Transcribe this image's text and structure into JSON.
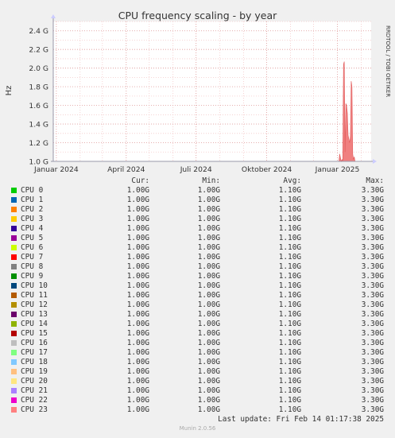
{
  "chart_data": {
    "type": "area",
    "title": "CPU frequency scaling - by year",
    "ylabel": "Hz",
    "watermark": "RRDTOOL / TOBI OETIKER",
    "ylim": [
      1.0,
      2.5
    ],
    "yticks": [
      1.0,
      1.2,
      1.4,
      1.6,
      1.8,
      2.0,
      2.2,
      2.4
    ],
    "ytick_labels": [
      "1.0 G",
      "1.2 G",
      "1.4 G",
      "1.6 G",
      "1.8 G",
      "2.0 G",
      "2.2 G",
      "2.4 G"
    ],
    "xlim": [
      "2023-12-28",
      "2025-02-14"
    ],
    "xticks": [
      "2024-01-01",
      "2024-04-01",
      "2024-07-01",
      "2024-10-01",
      "2025-01-01"
    ],
    "xtick_labels": [
      "Januar 2024",
      "April 2024",
      "Juli 2024",
      "Oktober 2024",
      "Januar 2025"
    ],
    "grid": true,
    "series": [
      {
        "name": "CPU 0",
        "color": "#f08080",
        "x": [
          "2025-01-03",
          "2025-01-04",
          "2025-01-06",
          "2025-01-07",
          "2025-01-08",
          "2025-01-09",
          "2025-01-10",
          "2025-01-11",
          "2025-01-12",
          "2025-01-13",
          "2025-01-14",
          "2025-01-15",
          "2025-01-17",
          "2025-01-18",
          "2025-01-19",
          "2025-01-20",
          "2025-01-21",
          "2025-01-22",
          "2025-01-23",
          "2025-01-24"
        ],
        "values": [
          1.0,
          1.08,
          1.0,
          1.02,
          1.0,
          2.04,
          2.07,
          1.1,
          1.62,
          1.6,
          1.52,
          1.28,
          1.2,
          1.27,
          1.86,
          1.8,
          1.08,
          1.02,
          1.05,
          1.0
        ]
      }
    ]
  },
  "legend": {
    "headers": {
      "cur": "Cur:",
      "min": "Min:",
      "avg": "Avg:",
      "max": "Max:"
    },
    "rows": [
      {
        "name": "CPU 0",
        "color": "#00cc00",
        "cur": "1.00G",
        "min": "1.00G",
        "avg": "1.10G",
        "max": "3.30G"
      },
      {
        "name": "CPU 1",
        "color": "#0066b3",
        "cur": "1.00G",
        "min": "1.00G",
        "avg": "1.10G",
        "max": "3.30G"
      },
      {
        "name": "CPU 2",
        "color": "#ff8000",
        "cur": "1.00G",
        "min": "1.00G",
        "avg": "1.10G",
        "max": "3.30G"
      },
      {
        "name": "CPU 3",
        "color": "#ffcc00",
        "cur": "1.00G",
        "min": "1.00G",
        "avg": "1.10G",
        "max": "3.30G"
      },
      {
        "name": "CPU 4",
        "color": "#330099",
        "cur": "1.00G",
        "min": "1.00G",
        "avg": "1.10G",
        "max": "3.30G"
      },
      {
        "name": "CPU 5",
        "color": "#990099",
        "cur": "1.00G",
        "min": "1.00G",
        "avg": "1.10G",
        "max": "3.30G"
      },
      {
        "name": "CPU 6",
        "color": "#ccff00",
        "cur": "1.00G",
        "min": "1.00G",
        "avg": "1.10G",
        "max": "3.30G"
      },
      {
        "name": "CPU 7",
        "color": "#ff0000",
        "cur": "1.00G",
        "min": "1.00G",
        "avg": "1.10G",
        "max": "3.30G"
      },
      {
        "name": "CPU 8",
        "color": "#808080",
        "cur": "1.00G",
        "min": "1.00G",
        "avg": "1.10G",
        "max": "3.30G"
      },
      {
        "name": "CPU 9",
        "color": "#008f00",
        "cur": "1.00G",
        "min": "1.00G",
        "avg": "1.10G",
        "max": "3.30G"
      },
      {
        "name": "CPU 10",
        "color": "#00487d",
        "cur": "1.00G",
        "min": "1.00G",
        "avg": "1.10G",
        "max": "3.30G"
      },
      {
        "name": "CPU 11",
        "color": "#b35a00",
        "cur": "1.00G",
        "min": "1.00G",
        "avg": "1.10G",
        "max": "3.30G"
      },
      {
        "name": "CPU 12",
        "color": "#b38f00",
        "cur": "1.00G",
        "min": "1.00G",
        "avg": "1.10G",
        "max": "3.30G"
      },
      {
        "name": "CPU 13",
        "color": "#6b006b",
        "cur": "1.00G",
        "min": "1.00G",
        "avg": "1.10G",
        "max": "3.30G"
      },
      {
        "name": "CPU 14",
        "color": "#8fb300",
        "cur": "1.00G",
        "min": "1.00G",
        "avg": "1.10G",
        "max": "3.30G"
      },
      {
        "name": "CPU 15",
        "color": "#b30000",
        "cur": "1.00G",
        "min": "1.00G",
        "avg": "1.10G",
        "max": "3.30G"
      },
      {
        "name": "CPU 16",
        "color": "#bebebe",
        "cur": "1.00G",
        "min": "1.00G",
        "avg": "1.10G",
        "max": "3.30G"
      },
      {
        "name": "CPU 17",
        "color": "#80ff80",
        "cur": "1.00G",
        "min": "1.00G",
        "avg": "1.10G",
        "max": "3.30G"
      },
      {
        "name": "CPU 18",
        "color": "#80c9ff",
        "cur": "1.00G",
        "min": "1.00G",
        "avg": "1.10G",
        "max": "3.30G"
      },
      {
        "name": "CPU 19",
        "color": "#ffc080",
        "cur": "1.00G",
        "min": "1.00G",
        "avg": "1.10G",
        "max": "3.30G"
      },
      {
        "name": "CPU 20",
        "color": "#ffe680",
        "cur": "1.00G",
        "min": "1.00G",
        "avg": "1.10G",
        "max": "3.30G"
      },
      {
        "name": "CPU 21",
        "color": "#aa80ff",
        "cur": "1.00G",
        "min": "1.00G",
        "avg": "1.10G",
        "max": "3.30G"
      },
      {
        "name": "CPU 22",
        "color": "#ee00cc",
        "cur": "1.00G",
        "min": "1.00G",
        "avg": "1.10G",
        "max": "3.30G"
      },
      {
        "name": "CPU 23",
        "color": "#ff8080",
        "cur": "1.00G",
        "min": "1.00G",
        "avg": "1.10G",
        "max": "3.30G"
      }
    ]
  },
  "last_update": "Last update: Fri Feb 14 01:17:38 2025",
  "footer": "Munin 2.0.56"
}
